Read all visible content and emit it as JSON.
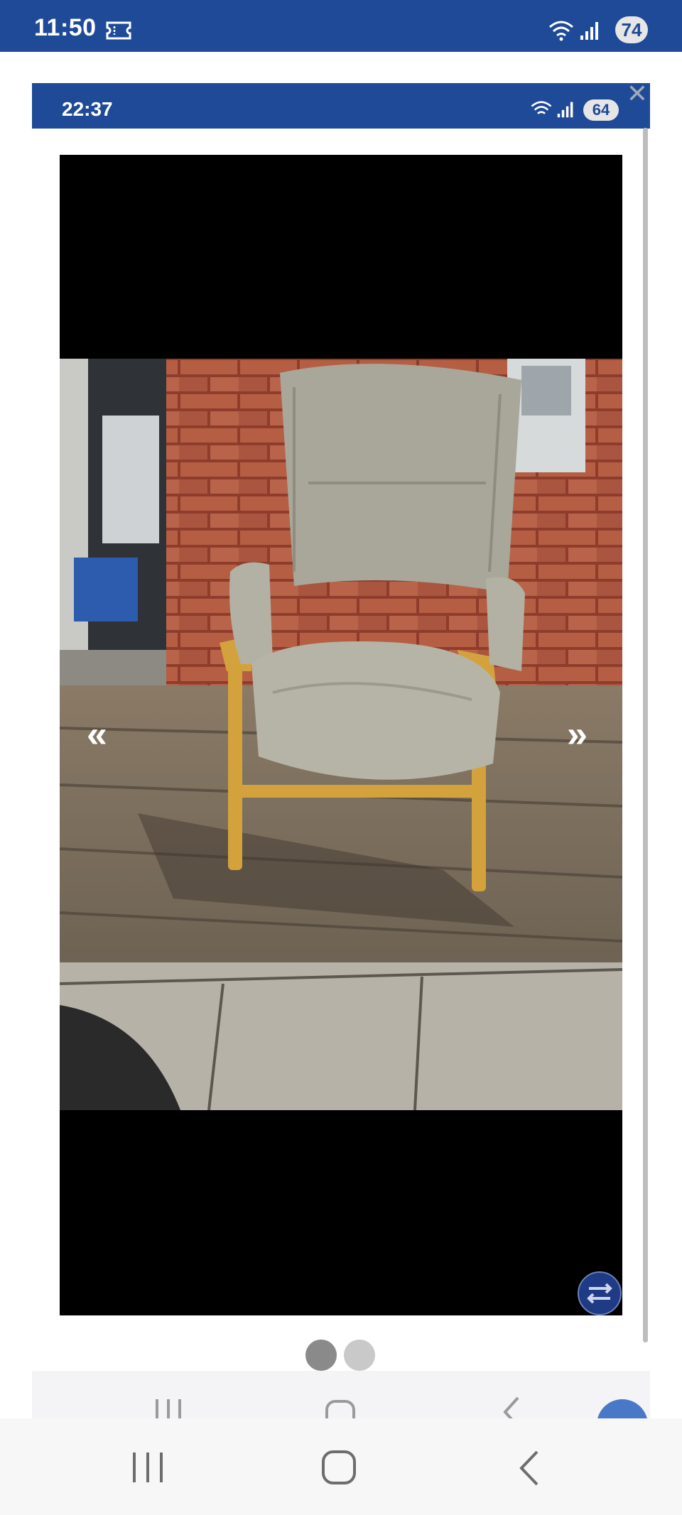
{
  "status_bar": {
    "time": "11:50",
    "battery": "74"
  },
  "inner_status_bar": {
    "time": "22:37",
    "battery": "64"
  },
  "viewer": {
    "nav_prev_label": "«",
    "nav_next_label": "»",
    "pagination": {
      "count": 2,
      "active_index": 0
    }
  },
  "icons": {
    "close": "close-icon",
    "swap": "swap-arrows-icon",
    "recent_apps": "recent-apps-icon",
    "home": "home-icon",
    "back": "back-icon"
  },
  "colors": {
    "brand_blue": "#1f4a98",
    "viewer_background": "#000000",
    "dot_active": "#8a8a8a",
    "dot_inactive": "#c9c9c9"
  }
}
